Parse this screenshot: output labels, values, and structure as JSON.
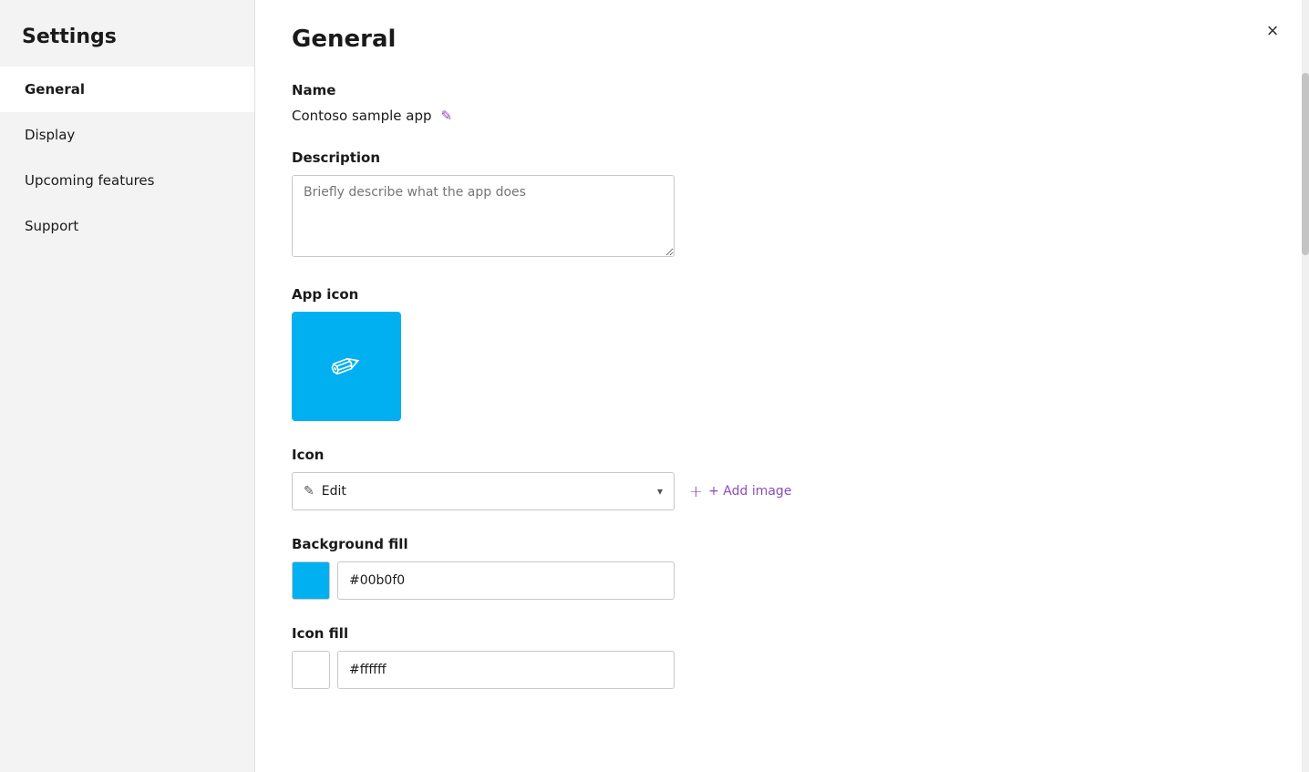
{
  "sidebar": {
    "title": "Settings",
    "items": [
      {
        "id": "general",
        "label": "General",
        "active": true
      },
      {
        "id": "display",
        "label": "Display",
        "active": false
      },
      {
        "id": "upcoming-features",
        "label": "Upcoming features",
        "active": false
      },
      {
        "id": "support",
        "label": "Support",
        "active": false
      }
    ]
  },
  "main": {
    "page_title": "General",
    "close_label": "×",
    "sections": {
      "name": {
        "label": "Name",
        "value": "Contoso sample app",
        "edit_icon": "✎"
      },
      "description": {
        "label": "Description",
        "placeholder": "Briefly describe what the app does"
      },
      "app_icon": {
        "label": "App icon"
      },
      "icon": {
        "label": "Icon",
        "dropdown_value": "Edit",
        "dropdown_icon": "✎",
        "add_image_label": "+ Add image",
        "add_icon": "+"
      },
      "background_fill": {
        "label": "Background fill",
        "color": "#00b0f0",
        "color_value": "#00b0f0"
      },
      "icon_fill": {
        "label": "Icon fill",
        "color": "#ffffff",
        "color_value": "#ffffff"
      }
    }
  }
}
